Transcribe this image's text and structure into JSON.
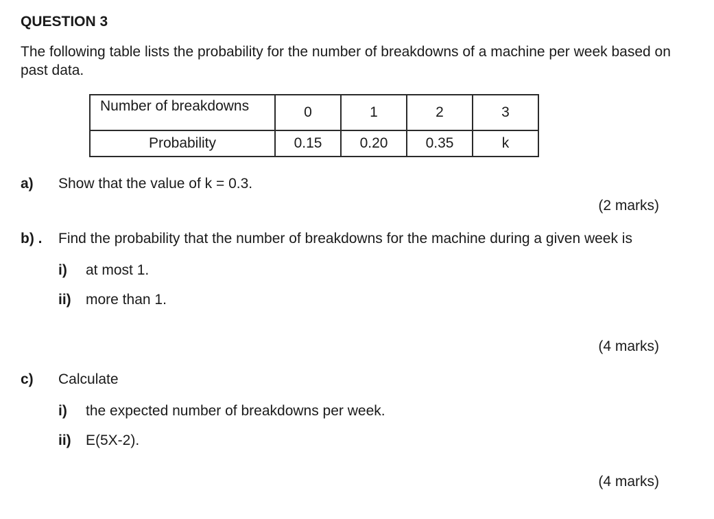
{
  "title": "QUESTION 3",
  "intro": "The following table lists the probability for the number of breakdowns of a machine per week based on past data.",
  "table": {
    "header_row_label": "Number of breakdowns",
    "prob_row_label": "Probability",
    "cols": [
      "0",
      "1",
      "2",
      "3"
    ],
    "probs": [
      "0.15",
      "0.20",
      "0.35",
      "k"
    ]
  },
  "parts": {
    "a": {
      "label": "a)",
      "text": "Show that the value of k = 0.3.",
      "marks": "(2 marks)"
    },
    "b": {
      "label": "b) .",
      "text": "Find the probability that the number of breakdowns for the machine during a given week is",
      "sub": {
        "i": {
          "label": "i)",
          "text": "at most 1."
        },
        "ii": {
          "label": "ii)",
          "text": "more than 1."
        }
      },
      "marks": "(4 marks)"
    },
    "c": {
      "label": "c)",
      "text": "Calculate",
      "sub": {
        "i": {
          "label": "i)",
          "text": "the expected number of breakdowns per week."
        },
        "ii": {
          "label": "ii)",
          "text": "E(5X-2)."
        }
      },
      "marks": "(4 marks)"
    }
  }
}
